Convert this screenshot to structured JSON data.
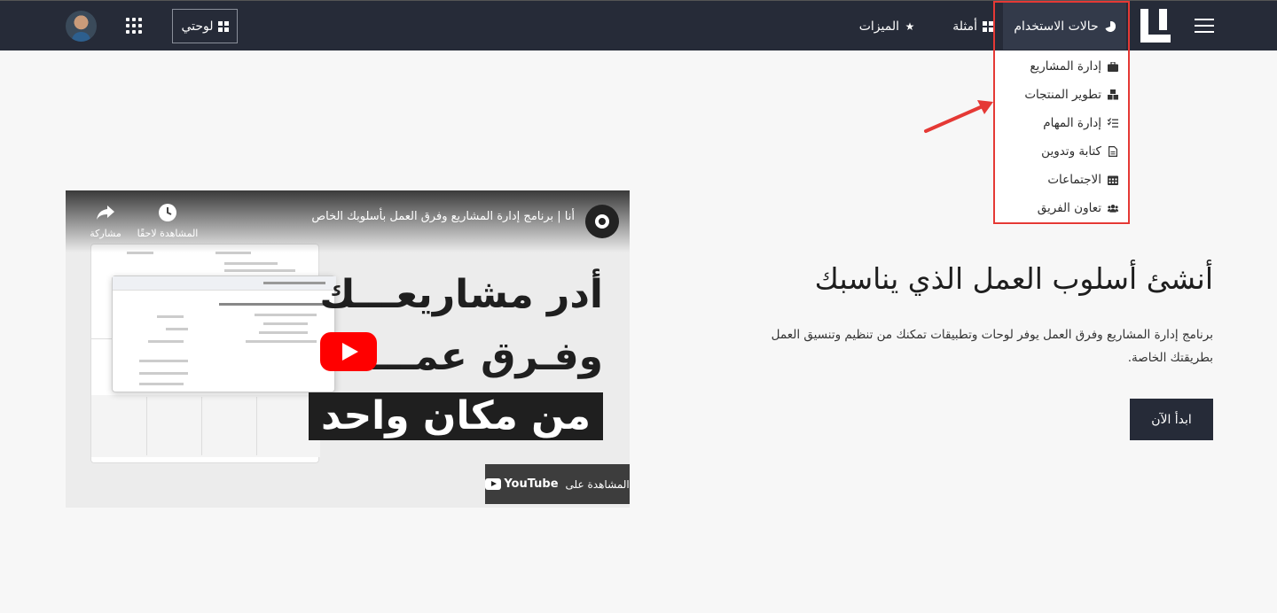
{
  "nav": {
    "use_cases": "حالات الاستخدام",
    "examples": "أمثلة",
    "features": "الميزات",
    "my_board": "لوحتي"
  },
  "dropdown": {
    "items": [
      {
        "label": "إدارة المشاريع",
        "icon": "briefcase-icon"
      },
      {
        "label": "تطوير المنتجات",
        "icon": "cubes-icon"
      },
      {
        "label": "إدارة المهام",
        "icon": "tasks-icon"
      },
      {
        "label": "كتابة وتدوين",
        "icon": "file-icon"
      },
      {
        "label": "الاجتماعات",
        "icon": "calendar-icon"
      },
      {
        "label": "تعاون الفريق",
        "icon": "users-icon"
      }
    ]
  },
  "hero": {
    "title": "أنشئ أسلوب العمل الذي يناسبك",
    "description": "برنامج إدارة المشاريع وفرق العمل يوفر لوحات وتطبيقات تمكنك من تنظيم وتنسيق العمل بطريقتك الخاصة.",
    "cta": "ابدأ الآن"
  },
  "video": {
    "title": "أنا | برنامج إدارة المشاريع وفرق العمل بأسلوبك الخاص",
    "watch_later": "المشاهدة لاحقًا",
    "share": "مشاركة",
    "headline_1": "أدر مشاريعـــك",
    "headline_2": "وفـرق عمـــلك",
    "headline_3": "من مكان واحد",
    "watch_on": "المشاهدة على",
    "youtube": "YouTube"
  },
  "colors": {
    "topbar": "#262b38",
    "highlight": "#e53935",
    "youtube_red": "#ff0000"
  }
}
